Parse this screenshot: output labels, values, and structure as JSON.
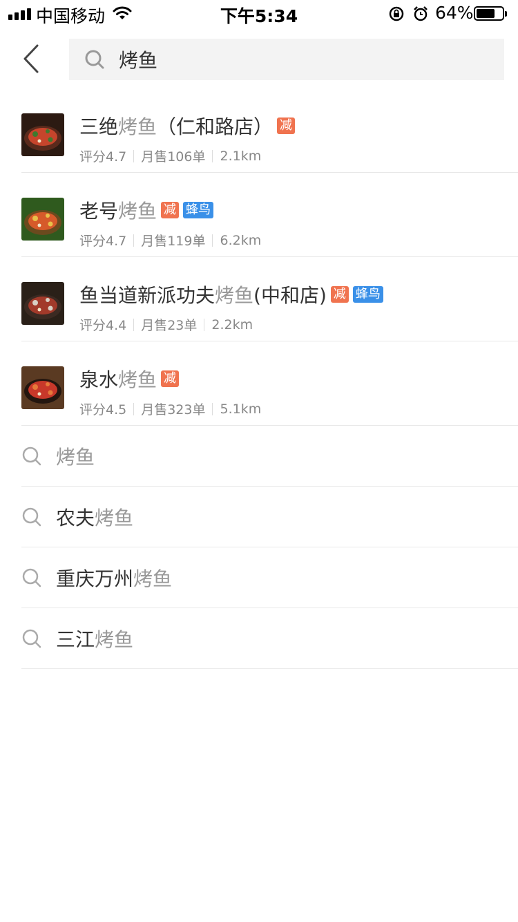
{
  "status_bar": {
    "carrier": "中国移动",
    "time": "下午5:34",
    "battery_pct": "64%",
    "battery_level": 0.64
  },
  "search": {
    "query": "烤鱼"
  },
  "shops": [
    {
      "name_prefix": "三绝",
      "name_highlight": "烤鱼",
      "name_suffix": "（仁和路店）",
      "tags": [
        "减"
      ],
      "rating": "评分4.7",
      "sales": "月售106单",
      "distance": "2.1km"
    },
    {
      "name_prefix": "老号",
      "name_highlight": "烤鱼",
      "name_suffix": "",
      "tags": [
        "减",
        "蜂鸟"
      ],
      "rating": "评分4.7",
      "sales": "月售119单",
      "distance": "6.2km"
    },
    {
      "name_prefix": "鱼当道新派功夫",
      "name_highlight": "烤鱼",
      "name_suffix": "(中和店)",
      "tags": [
        "减",
        "蜂鸟"
      ],
      "rating": "评分4.4",
      "sales": "月售23单",
      "distance": "2.2km"
    },
    {
      "name_prefix": "泉水",
      "name_highlight": "烤鱼",
      "name_suffix": "",
      "tags": [
        "减"
      ],
      "rating": "评分4.5",
      "sales": "月售323单",
      "distance": "5.1km"
    }
  ],
  "suggestions": [
    {
      "prefix": "",
      "highlight": "烤鱼"
    },
    {
      "prefix": "农夫",
      "highlight": "烤鱼"
    },
    {
      "prefix": "重庆万州",
      "highlight": "烤鱼"
    },
    {
      "prefix": "三江",
      "highlight": "烤鱼"
    }
  ],
  "colors": {
    "highlight": "#999999",
    "tag_reduce": "#f0734f",
    "tag_bird": "#3a90e8",
    "search_bg": "#f3f3f3"
  }
}
